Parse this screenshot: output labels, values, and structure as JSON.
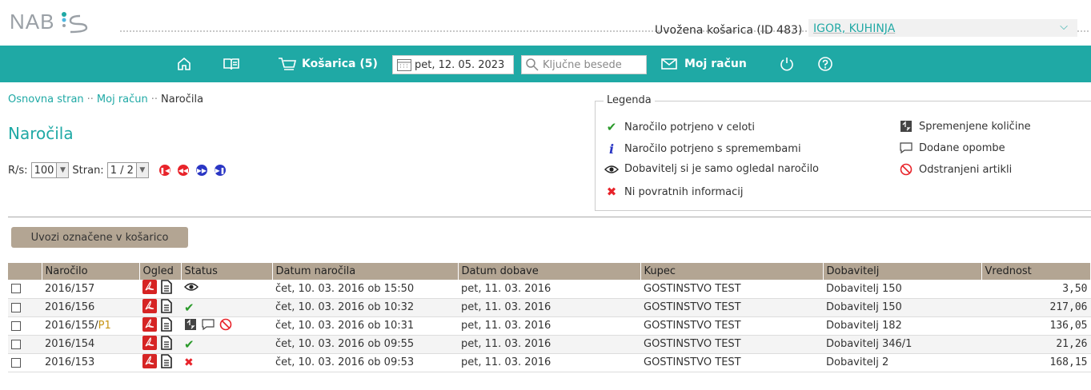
{
  "brand": "NAB:S",
  "header": {
    "basket_info": "Uvožena košarica (ID 483)",
    "customer": "IGOR, KUHINJA"
  },
  "nav": {
    "cart_label": "Košarica (5)",
    "date": "pet, 12. 05. 2023",
    "search_placeholder": "Ključne besede",
    "account_label": "Moj račun"
  },
  "breadcrumb": [
    "Osnovna stran",
    "Moj račun",
    "Naročila"
  ],
  "page_title": "Naročila",
  "pager": {
    "rs_label": "R/s:",
    "rs_value": "100",
    "page_label": "Stran:",
    "page_value": "1 / 2"
  },
  "legend": {
    "title": "Legenda",
    "items": [
      "Naročilo potrjeno v celoti",
      "Naročilo potrjeno s spremembami",
      "Dobavitelj si je samo ogledal naročilo",
      "Ni povratnih informacij",
      "Spremenjene količine",
      "Dodane opombe",
      "Odstranjeni artikli"
    ]
  },
  "import_button": "Uvozi označene v košarico",
  "table": {
    "columns": [
      "Naročilo",
      "Ogled",
      "Status",
      "Datum naročila",
      "Datum dobave",
      "Kupec",
      "Dobavitelj",
      "Vrednost"
    ],
    "rows": [
      {
        "order": "2016/157",
        "suffix": "",
        "status": [
          "eye"
        ],
        "order_date": "čet, 10. 03. 2016 ob 15:50",
        "delivery": "pet, 11. 03. 2016",
        "buyer": "GOSTINSTVO TEST",
        "supplier": "Dobavitelj 150",
        "value": "3,50"
      },
      {
        "order": "2016/156",
        "suffix": "",
        "status": [
          "check"
        ],
        "order_date": "čet, 10. 03. 2016 ob 10:32",
        "delivery": "pet, 11. 03. 2016",
        "buyer": "GOSTINSTVO TEST",
        "supplier": "Dobavitelj 150",
        "value": "217,06"
      },
      {
        "order": "2016/155/",
        "suffix": "P1",
        "status": [
          "qty",
          "comment",
          "removed"
        ],
        "order_date": "čet, 10. 03. 2016 ob 10:31",
        "delivery": "pet, 11. 03. 2016",
        "buyer": "GOSTINSTVO TEST",
        "supplier": "Dobavitelj 182",
        "value": "136,05"
      },
      {
        "order": "2016/154",
        "suffix": "",
        "status": [
          "check"
        ],
        "order_date": "čet, 10. 03. 2016 ob 09:55",
        "delivery": "pet, 11. 03. 2016",
        "buyer": "GOSTINSTVO TEST",
        "supplier": "Dobavitelj 346/1",
        "value": "21,26"
      },
      {
        "order": "2016/153",
        "suffix": "",
        "status": [
          "cross"
        ],
        "order_date": "čet, 10. 03. 2016 ob 09:53",
        "delivery": "pet, 11. 03. 2016",
        "buyer": "GOSTINSTVO TEST",
        "supplier": "Dobavitelj 2",
        "value": "168,15"
      }
    ]
  },
  "colors": {
    "teal": "#1fa9a5",
    "tan": "#b3a593",
    "red": "#e8232a",
    "blue": "#2a36c4"
  }
}
